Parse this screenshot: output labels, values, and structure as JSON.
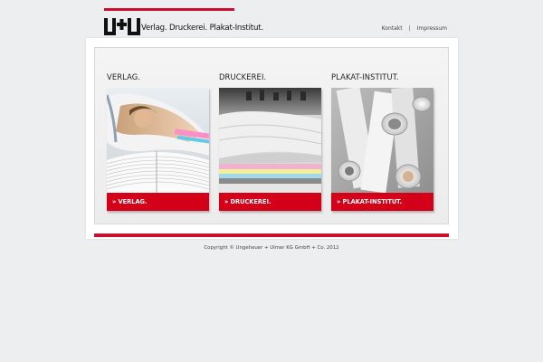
{
  "brand": {
    "tagline": "Verlag. Druckerei. Plakat-Institut.",
    "accent_color": "#c8102e"
  },
  "topnav": {
    "items": [
      {
        "label": "Kontakt"
      },
      {
        "label": "Impressum"
      }
    ],
    "separator": "|"
  },
  "sections": [
    {
      "title": "VERLAG.",
      "button_label": "» VERLAG.",
      "image": "magazines-photo"
    },
    {
      "title": "DRUCKEREI.",
      "button_label": "» DRUCKEREI.",
      "image": "printing-press-photo"
    },
    {
      "title": "PLAKAT-INSTITUT.",
      "button_label": "» PLAKAT-INSTITUT.",
      "image": "poster-rolls-photo"
    }
  ],
  "footer": {
    "copyright": "Copyright © Ungeheuer + Ulmer KG GmbH + Co. 2012"
  }
}
